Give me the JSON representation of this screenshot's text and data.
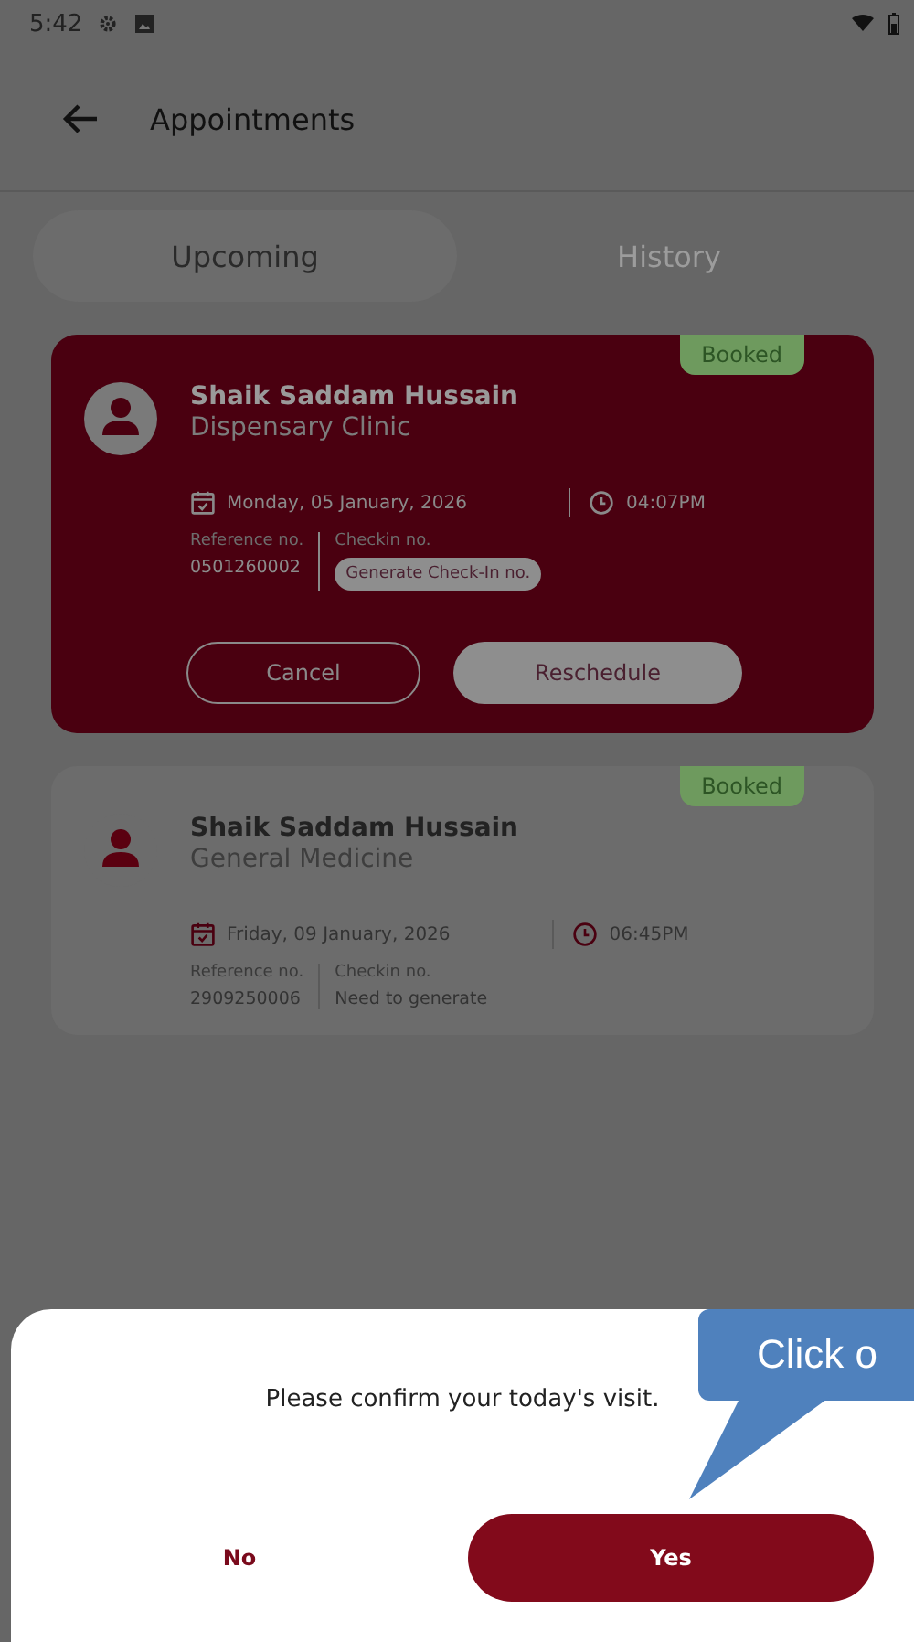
{
  "status_bar": {
    "time": "5:42"
  },
  "header": {
    "title": "Appointments"
  },
  "tabs": [
    {
      "label": "Upcoming",
      "selected": true
    },
    {
      "label": "History",
      "selected": false
    }
  ],
  "appointments": [
    {
      "highlighted": true,
      "status": "Booked",
      "name": "Shaik Saddam Hussain",
      "department": "Dispensary Clinic",
      "date": "Monday, 05 January, 2026",
      "time": "04:07PM",
      "reference_label": "Reference no.",
      "reference": "0501260002",
      "checkin_label": "Checkin no.",
      "checkin": {
        "kind": "button",
        "text": "Generate Check-In no."
      },
      "actions": [
        {
          "label": "Cancel",
          "kind": "outline"
        },
        {
          "label": "Reschedule",
          "kind": "filled"
        }
      ]
    },
    {
      "highlighted": false,
      "status": "Booked",
      "name": "Shaik Saddam Hussain",
      "department": "General Medicine",
      "date": "Friday, 09 January, 2026",
      "time": "06:45PM",
      "reference_label": "Reference no.",
      "reference": "2909250006",
      "checkin_label": "Checkin no.",
      "checkin": {
        "kind": "text",
        "text": "Need to generate"
      }
    }
  ],
  "dialog": {
    "message": "Please confirm your today's visit.",
    "buttons": [
      {
        "label": "No",
        "kind": "text"
      },
      {
        "label": "Yes",
        "kind": "filled"
      }
    ]
  },
  "callout": {
    "text": "Click o"
  }
}
